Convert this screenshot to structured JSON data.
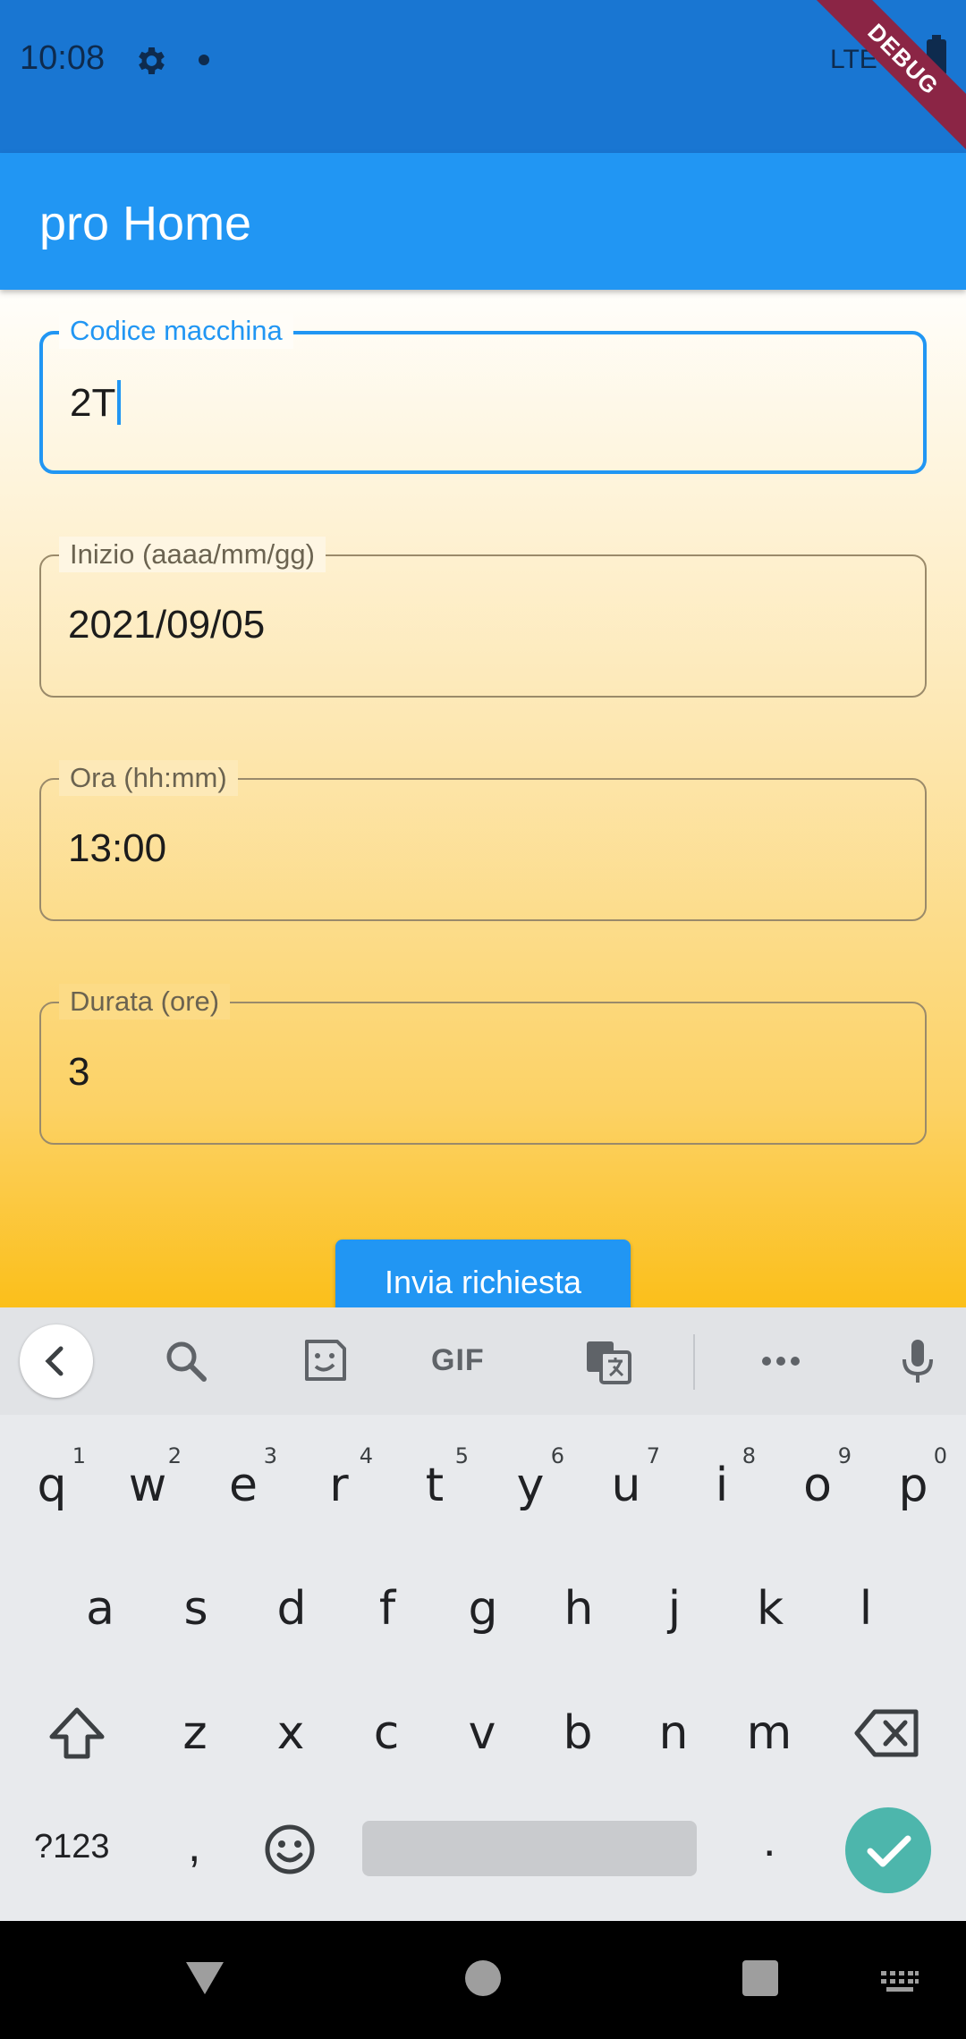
{
  "status_bar": {
    "time": "10:08",
    "network": "LTE",
    "debug_label": "DEBUG"
  },
  "app_bar": {
    "title": "pro Home"
  },
  "form": {
    "fields": [
      {
        "label": "Codice macchina",
        "value": "2T",
        "focused": true
      },
      {
        "label": "Inizio (aaaa/mm/gg)",
        "value": "2021/09/05",
        "focused": false
      },
      {
        "label": "Ora (hh:mm)",
        "value": "13:00",
        "focused": false
      },
      {
        "label": "Durata (ore)",
        "value": "3",
        "focused": false
      }
    ],
    "submit_label": "Invia richiesta"
  },
  "keyboard": {
    "toolbar": {
      "gif_label": "GIF"
    },
    "row1": [
      {
        "ch": "q",
        "sup": "1"
      },
      {
        "ch": "w",
        "sup": "2"
      },
      {
        "ch": "e",
        "sup": "3"
      },
      {
        "ch": "r",
        "sup": "4"
      },
      {
        "ch": "t",
        "sup": "5"
      },
      {
        "ch": "y",
        "sup": "6"
      },
      {
        "ch": "u",
        "sup": "7"
      },
      {
        "ch": "i",
        "sup": "8"
      },
      {
        "ch": "o",
        "sup": "9"
      },
      {
        "ch": "p",
        "sup": "0"
      }
    ],
    "row2": [
      "a",
      "s",
      "d",
      "f",
      "g",
      "h",
      "j",
      "k",
      "l"
    ],
    "row3": [
      "z",
      "x",
      "c",
      "v",
      "b",
      "n",
      "m"
    ],
    "symbols_label": "?123",
    "comma": ",",
    "period": "."
  },
  "colors": {
    "status_bar": "#1976D2",
    "app_bar": "#2196F3",
    "accent": "#2196F3",
    "debug_banner": "#8b2545",
    "enter_key": "#4db6ac"
  }
}
